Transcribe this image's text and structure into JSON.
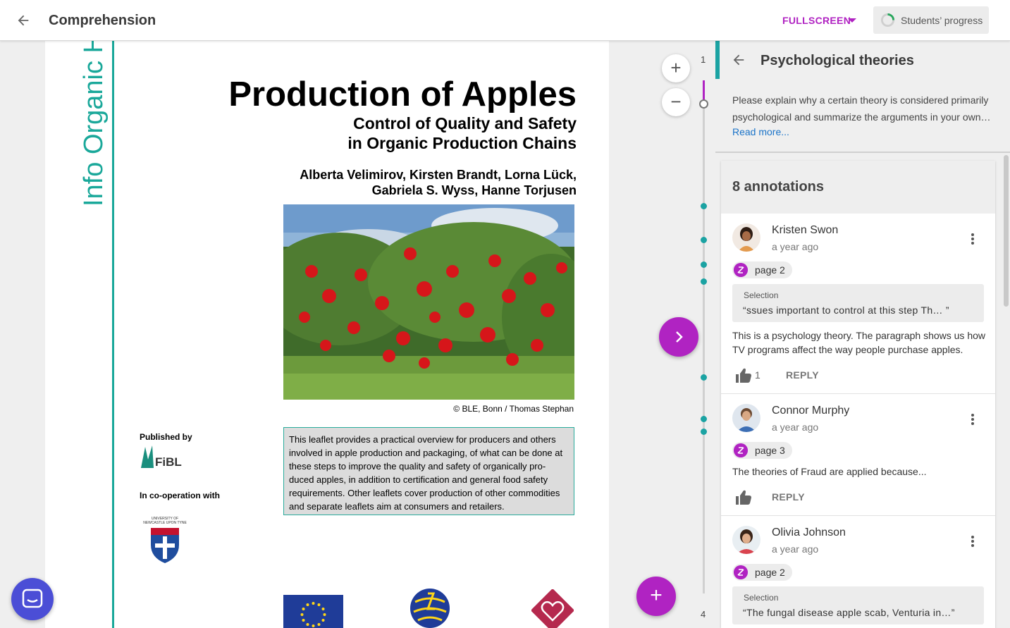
{
  "topbar": {
    "title": "Comprehension",
    "fullscreen_label": "FULLSCREEN",
    "progress_label": "Students’ progress"
  },
  "document": {
    "side_title": "Info Organic H",
    "title": "Production of Apples",
    "subtitle": "Control of Quality and Safety\nin Organic Production Chains",
    "authors": "Alberta Velimirov, Kirsten Brandt, Lorna Lück,\nGabriela S. Wyss, Hanne Torjusen",
    "photo_credit": "© BLE, Bonn / Thomas Stephan",
    "published_by": "Published by",
    "cooperation": "In co-operation with",
    "fibl_logo_text": "FiBL",
    "university_logo_text": "UNIVERSITY OF NEWCASTLE UPON TYNE",
    "summary": "This leaflet provides a practical overview for producers and others involved in apple production and packaging, of what can be done at these steps to improve the quality and safety of organically pro-duced apples, in addition to certification and general food safety requirements. Other leaflets cover production of other commodities and separate leaflets aim at consumers and retailers."
  },
  "navigator": {
    "page_top": "1",
    "page_bottom": "4",
    "zoom_in": "+",
    "zoom_out": "−",
    "add": "+"
  },
  "panel": {
    "title": "Psychological theories",
    "description": "Please explain why a certain theory is considered primarily psychological and summarize the arguments in your own…",
    "read_more": "Read more...",
    "annotation_count": "8 annotations",
    "annotations": [
      {
        "name": "Kristen Swon",
        "time": "a year ago",
        "page": "page 2",
        "selection_label": "Selection",
        "selection": "“ssues important to control at this step Th… ”",
        "body": "This is a psychology theory. The paragraph shows us how TV programs affect the way people purchase apples.",
        "likes": "1",
        "reply": "REPLY"
      },
      {
        "name": "Connor Murphy",
        "time": "a year ago",
        "page": "page 3",
        "body": "The theories of Fraud are applied because...",
        "reply": "REPLY"
      },
      {
        "name": "Olivia Johnson",
        "time": "a year ago",
        "page": "page 2",
        "selection_label": "Selection",
        "selection": "“The fungal disease apple scab, Venturia in…”"
      }
    ]
  },
  "colors": {
    "accent": "#b023c2",
    "teal": "#1aa89a",
    "link": "#1a73c8",
    "chat": "#4b4ed6"
  },
  "icons": [
    "back-arrow-icon",
    "caret-down-icon",
    "progress-ring-icon",
    "plus-icon",
    "minus-icon",
    "chevron-right-icon",
    "kebab-menu-icon",
    "annotation-chip-icon",
    "thumbs-up-icon",
    "chat-icon"
  ]
}
